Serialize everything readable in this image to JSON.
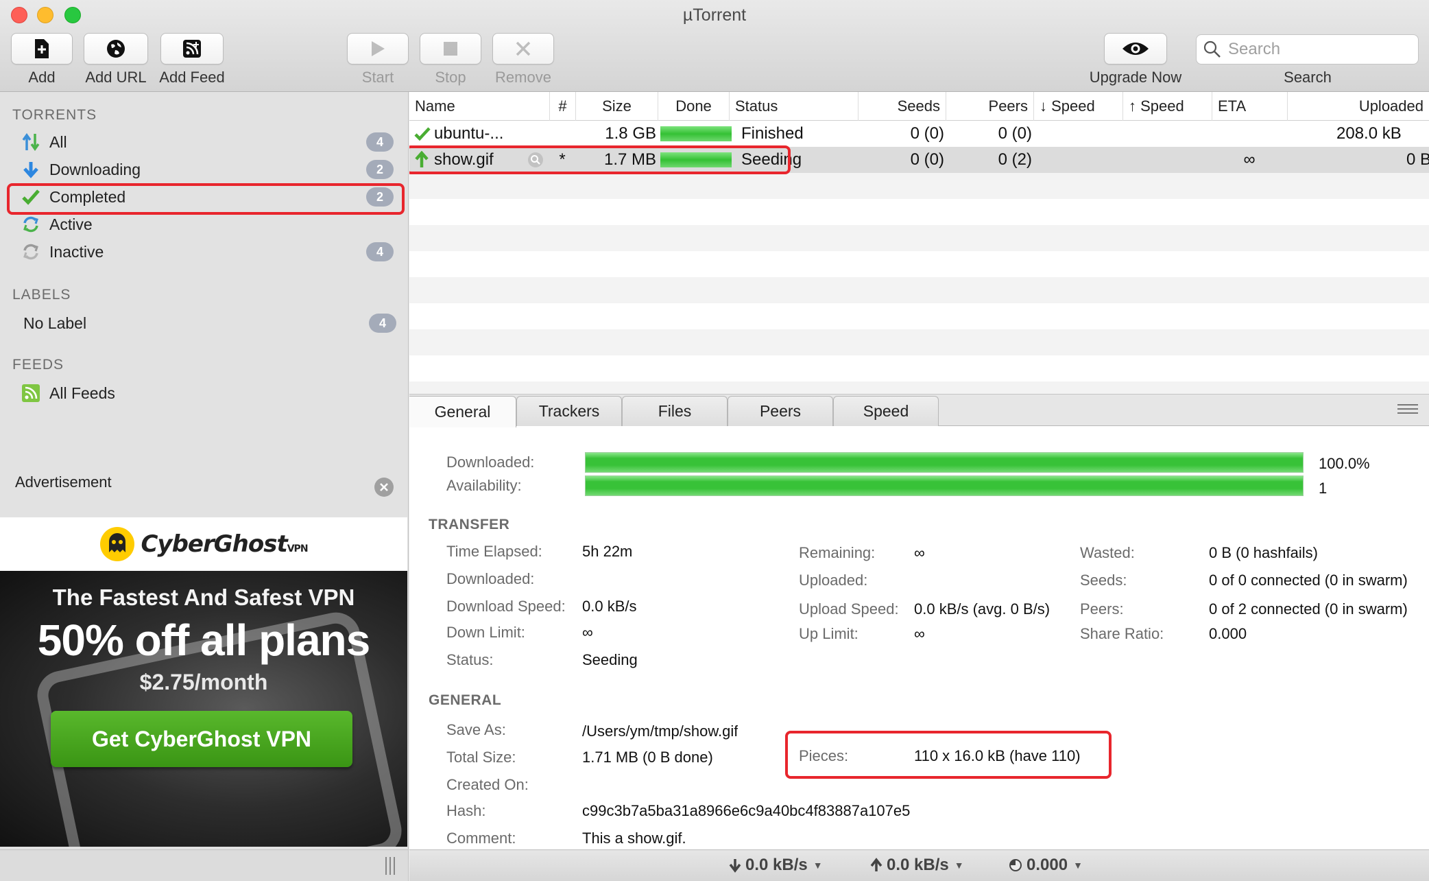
{
  "window": {
    "title": "µTorrent"
  },
  "toolbar": {
    "add": "Add",
    "add_url": "Add URL",
    "add_feed": "Add Feed",
    "start": "Start",
    "stop": "Stop",
    "remove": "Remove",
    "upgrade": "Upgrade Now",
    "search_placeholder": "Search",
    "search_label": "Search"
  },
  "sidebar": {
    "torrents_header": "TORRENTS",
    "items": [
      {
        "label": "All",
        "count": "4",
        "icon": "transfer-arrows-icon"
      },
      {
        "label": "Downloading",
        "count": "2",
        "icon": "download-arrow-icon"
      },
      {
        "label": "Completed",
        "count": "2",
        "icon": "checkmark-icon"
      },
      {
        "label": "Active",
        "count": "",
        "icon": "refresh-icon"
      },
      {
        "label": "Inactive",
        "count": "4",
        "icon": "refresh-gray-icon"
      }
    ],
    "labels_header": "LABELS",
    "no_label": {
      "label": "No Label",
      "count": "4"
    },
    "feeds_header": "FEEDS",
    "all_feeds": "All Feeds",
    "advertisement": "Advertisement"
  },
  "ad": {
    "brand": "CyberGhost",
    "brand_suffix": "VPN",
    "headline": "The Fastest And Safest VPN",
    "offer": "50% off all plans",
    "price": "$2.75/month",
    "cta": "Get CyberGhost VPN"
  },
  "list": {
    "columns": [
      "Name",
      "#",
      "Size",
      "Done",
      "Status",
      "Seeds",
      "Peers",
      "↓ Speed",
      "↑ Speed",
      "ETA",
      "Uploaded"
    ],
    "rows": [
      {
        "name": "ubuntu-...",
        "num": "",
        "size": "1.8 GB",
        "done": 1.0,
        "status": "Finished",
        "seeds": "0 (0)",
        "peers": "0 (0)",
        "down": "",
        "up": "",
        "eta": "",
        "uploaded": "208.0 kB",
        "icon": "checkmark-icon"
      },
      {
        "name": "show.gif",
        "num": "*",
        "size": "1.7 MB",
        "done": 1.0,
        "status": "Seeding",
        "seeds": "0 (0)",
        "peers": "0 (2)",
        "down": "",
        "up": "",
        "eta": "∞",
        "uploaded": "0 B",
        "icon": "upload-arrow-icon"
      }
    ]
  },
  "tabs": [
    "General",
    "Trackers",
    "Files",
    "Peers",
    "Speed"
  ],
  "general": {
    "downloaded_label": "Downloaded:",
    "downloaded_value": "100.0%",
    "downloaded_fraction": 1.0,
    "availability_label": "Availability:",
    "availability_value": "1",
    "transfer_header": "TRANSFER",
    "general_header": "GENERAL",
    "transfer": {
      "col1": [
        {
          "label": "Time Elapsed:",
          "value": "5h 22m"
        },
        {
          "label": "Downloaded:",
          "value": ""
        },
        {
          "label": "Download Speed:",
          "value": "0.0 kB/s"
        },
        {
          "label": "Down Limit:",
          "value": "∞"
        },
        {
          "label": "Status:",
          "value": "Seeding"
        }
      ],
      "col2": [
        {
          "label": "Remaining:",
          "value": "∞"
        },
        {
          "label": "Uploaded:",
          "value": ""
        },
        {
          "label": "Upload Speed:",
          "value": "0.0 kB/s (avg. 0 B/s)"
        },
        {
          "label": "Up Limit:",
          "value": "∞"
        }
      ],
      "col3": [
        {
          "label": "Wasted:",
          "value": "0 B (0 hashfails)"
        },
        {
          "label": "Seeds:",
          "value": "0 of 0 connected (0 in swarm)"
        },
        {
          "label": "Peers:",
          "value": "0 of 2 connected (0 in swarm)"
        },
        {
          "label": "Share Ratio:",
          "value": "0.000"
        }
      ]
    },
    "info": [
      {
        "label": "Save As:",
        "value": "/Users/ym/tmp/show.gif"
      },
      {
        "label": "Total Size:",
        "value": "1.71 MB (0 B done)"
      },
      {
        "label": "Created On:",
        "value": ""
      },
      {
        "label": "Hash:",
        "value": "c99c3b7a5ba31a8966e6c9a40bc4f83887a107e5"
      },
      {
        "label": "Comment:",
        "value": "This a show.gif."
      }
    ],
    "pieces_label": "Pieces:",
    "pieces_value": "110 x 16.0 kB (have 110)"
  },
  "statusbar": {
    "down": "0.0 kB/s",
    "up": "0.0 kB/s",
    "ratio": "0.000"
  },
  "colors": {
    "highlight": "#e8262d",
    "progress": "#38c238",
    "badge": "#a4abb9"
  }
}
